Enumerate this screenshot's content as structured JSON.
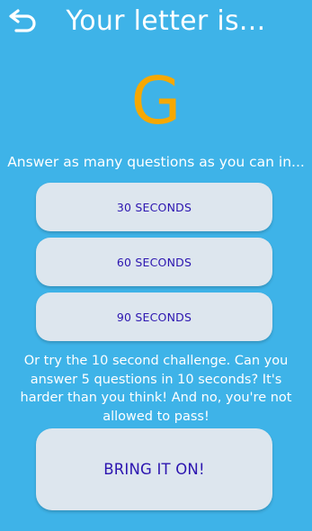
{
  "header": {
    "title": "Your letter is...",
    "back_icon": "back-arrow-icon"
  },
  "letter": "G",
  "prompt": "Answer as many questions as you can in...",
  "options": [
    {
      "label": "30 SECONDS"
    },
    {
      "label": "60 SECONDS"
    },
    {
      "label": "90 SECONDS"
    }
  ],
  "challenge": {
    "text": "Or try the 10 second challenge. Can you answer 5 questions in 10 seconds? It's harder than you think! And no, you're not allowed to pass!",
    "button_label": "BRING IT ON!"
  },
  "colors": {
    "background": "#3eb3e8",
    "letter": "#f6a800",
    "button_bg": "#dde6ee",
    "button_text": "#2c15b0"
  }
}
